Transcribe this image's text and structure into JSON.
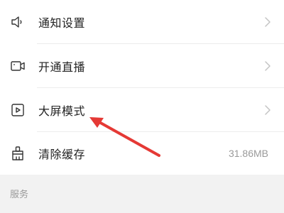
{
  "settings": {
    "items": [
      {
        "label": "通知设置",
        "icon": "speaker-icon",
        "has_chevron": true
      },
      {
        "label": "开通直播",
        "icon": "camera-icon",
        "has_chevron": true
      },
      {
        "label": "大屏模式",
        "icon": "play-square-icon",
        "has_chevron": true
      },
      {
        "label": "清除缓存",
        "icon": "broom-icon",
        "value": "31.86MB"
      }
    ]
  },
  "section": {
    "title": "服务"
  },
  "colors": {
    "text": "#222222",
    "muted": "#9a9a9a",
    "annotation_arrow": "#e53935",
    "section_bg": "#f2f2f2"
  }
}
